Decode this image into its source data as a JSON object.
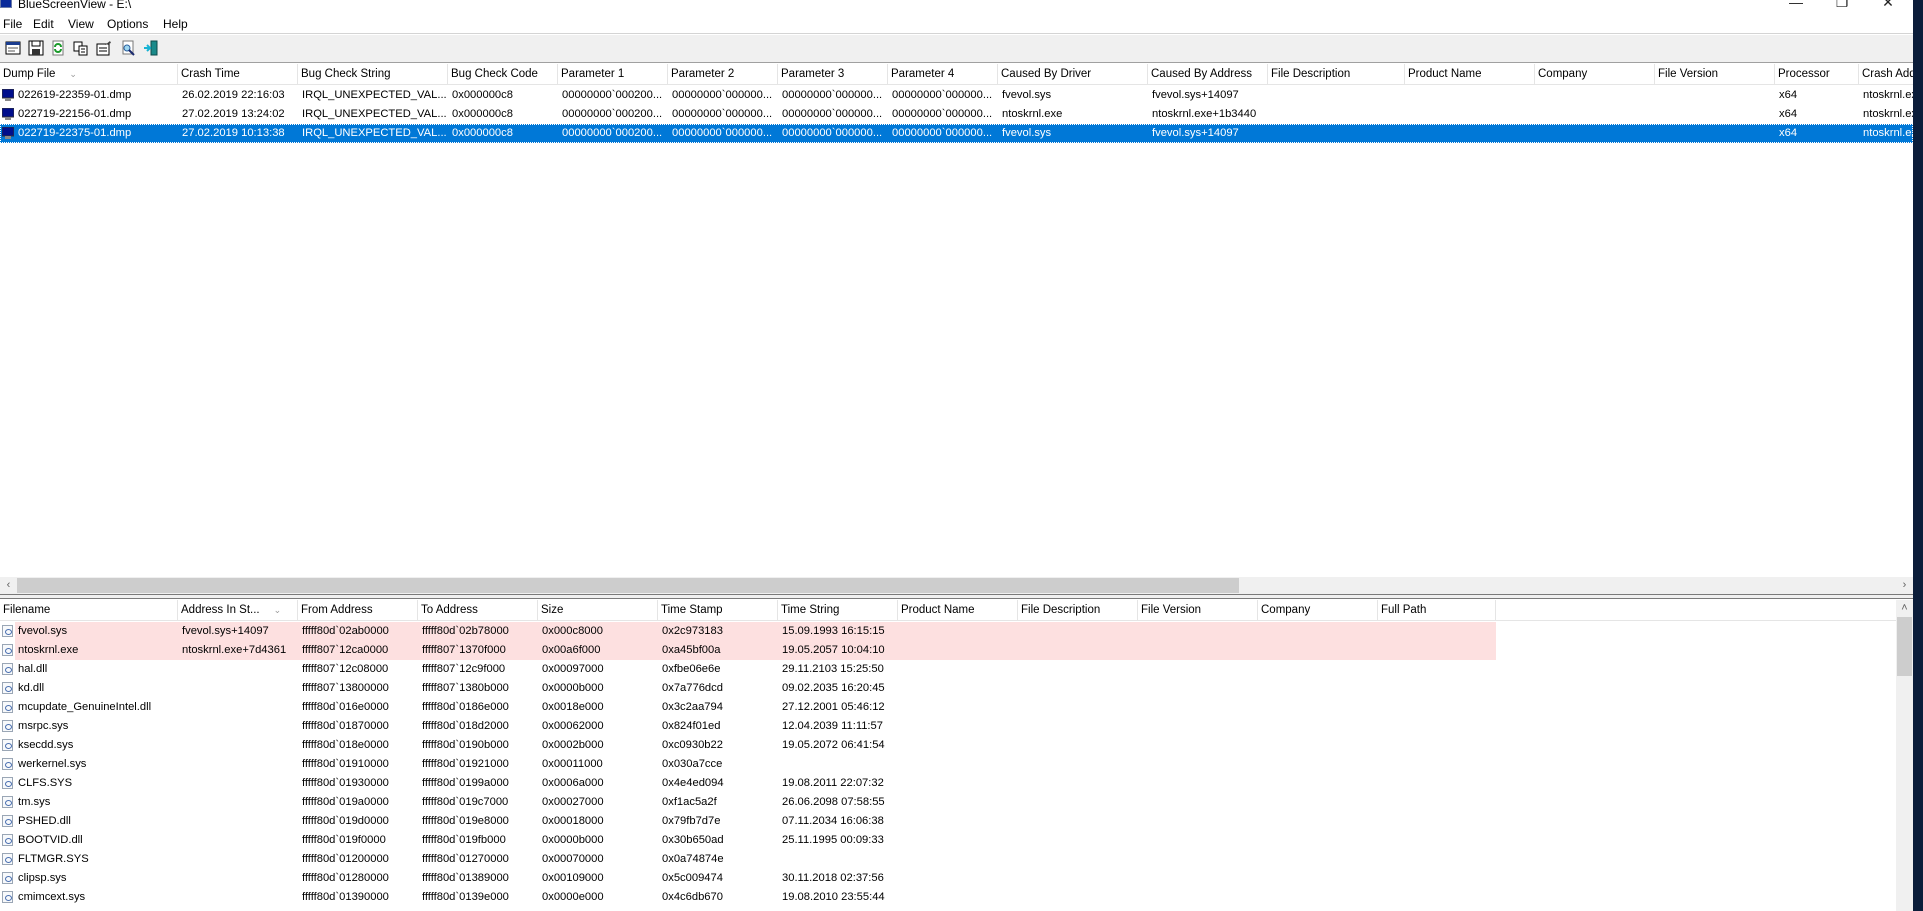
{
  "window": {
    "title": "BlueScreenView  -  E:\\",
    "controls": {
      "minimize": "—",
      "maximize": "❐",
      "close": "✕"
    }
  },
  "menu": [
    "File",
    "Edit",
    "View",
    "Options",
    "Help"
  ],
  "toolbar": [
    {
      "name": "properties-icon",
      "tooltip": "HTML report"
    },
    {
      "name": "save-icon",
      "tooltip": "Save"
    },
    {
      "name": "refresh-icon",
      "tooltip": "Refresh"
    },
    {
      "name": "copy-icon",
      "tooltip": "Copy"
    },
    {
      "name": "options-icon",
      "tooltip": "Properties"
    },
    {
      "name": "find-icon",
      "tooltip": "Find"
    },
    {
      "name": "exit-icon",
      "tooltip": "Exit"
    }
  ],
  "crash_list": {
    "columns": [
      "Dump File",
      "Crash Time",
      "Bug Check String",
      "Bug Check Code",
      "Parameter 1",
      "Parameter 2",
      "Parameter 3",
      "Parameter 4",
      "Caused By Driver",
      "Caused By Address",
      "File Description",
      "Product Name",
      "Company",
      "File Version",
      "Processor",
      "Crash Address"
    ],
    "sort_indicator": "⌄",
    "rows": [
      {
        "dump_file": "022619-22359-01.dmp",
        "crash_time": "26.02.2019 22:16:03",
        "bug_check_string": "IRQL_UNEXPECTED_VAL...",
        "bug_check_code": "0x000000c8",
        "p1": "00000000`000200...",
        "p2": "00000000`000000...",
        "p3": "00000000`000000...",
        "p4": "00000000`000000...",
        "driver": "fvevol.sys",
        "address": "fvevol.sys+14097",
        "file_desc": "",
        "product": "",
        "company": "",
        "file_version": "",
        "processor": "x64",
        "crash_address": "ntoskrnl.exe",
        "selected": false
      },
      {
        "dump_file": "022719-22156-01.dmp",
        "crash_time": "27.02.2019 13:24:02",
        "bug_check_string": "IRQL_UNEXPECTED_VAL...",
        "bug_check_code": "0x000000c8",
        "p1": "00000000`000200...",
        "p2": "00000000`000000...",
        "p3": "00000000`000000...",
        "p4": "00000000`000000...",
        "driver": "ntoskrnl.exe",
        "address": "ntoskrnl.exe+1b3440",
        "file_desc": "",
        "product": "",
        "company": "",
        "file_version": "",
        "processor": "x64",
        "crash_address": "ntoskrnl.exe",
        "selected": false
      },
      {
        "dump_file": "022719-22375-01.dmp",
        "crash_time": "27.02.2019 10:13:38",
        "bug_check_string": "IRQL_UNEXPECTED_VAL...",
        "bug_check_code": "0x000000c8",
        "p1": "00000000`000200...",
        "p2": "00000000`000000...",
        "p3": "00000000`000000...",
        "p4": "00000000`000000...",
        "driver": "fvevol.sys",
        "address": "fvevol.sys+14097",
        "file_desc": "",
        "product": "",
        "company": "",
        "file_version": "",
        "processor": "x64",
        "crash_address": "ntoskrnl.exe",
        "selected": true
      }
    ]
  },
  "scroll": {
    "left": "‹",
    "right": "›",
    "up": "˄"
  },
  "module_list": {
    "columns": [
      "Filename",
      "Address In St...",
      "From Address",
      "To Address",
      "Size",
      "Time Stamp",
      "Time String",
      "Product Name",
      "File Description",
      "File Version",
      "Company",
      "Full Path"
    ],
    "sort_indicator": "⌄",
    "highlight_color": "#fde0e0",
    "rows": [
      {
        "filename": "fvevol.sys",
        "addr_in_stack": "fvevol.sys+14097",
        "from": "fffff80d`02ab0000",
        "to": "fffff80d`02b78000",
        "size": "0x000c8000",
        "timestamp": "0x2c973183",
        "timestring": "15.09.1993 16:15:15",
        "highlight": true
      },
      {
        "filename": "ntoskrnl.exe",
        "addr_in_stack": "ntoskrnl.exe+7d4361",
        "from": "fffff807`12ca0000",
        "to": "fffff807`1370f000",
        "size": "0x00a6f000",
        "timestamp": "0xa45bf00a",
        "timestring": "19.05.2057 10:04:10",
        "highlight": true
      },
      {
        "filename": "hal.dll",
        "addr_in_stack": "",
        "from": "fffff807`12c08000",
        "to": "fffff807`12c9f000",
        "size": "0x00097000",
        "timestamp": "0xfbe06e6e",
        "timestring": "29.11.2103 15:25:50",
        "highlight": false
      },
      {
        "filename": "kd.dll",
        "addr_in_stack": "",
        "from": "fffff807`13800000",
        "to": "fffff807`1380b000",
        "size": "0x0000b000",
        "timestamp": "0x7a776dcd",
        "timestring": "09.02.2035 16:20:45",
        "highlight": false
      },
      {
        "filename": "mcupdate_GenuineIntel.dll",
        "addr_in_stack": "",
        "from": "fffff80d`016e0000",
        "to": "fffff80d`0186e000",
        "size": "0x0018e000",
        "timestamp": "0x3c2aa794",
        "timestring": "27.12.2001 05:46:12",
        "highlight": false
      },
      {
        "filename": "msrpc.sys",
        "addr_in_stack": "",
        "from": "fffff80d`01870000",
        "to": "fffff80d`018d2000",
        "size": "0x00062000",
        "timestamp": "0x824f01ed",
        "timestring": "12.04.2039 11:11:57",
        "highlight": false
      },
      {
        "filename": "ksecdd.sys",
        "addr_in_stack": "",
        "from": "fffff80d`018e0000",
        "to": "fffff80d`0190b000",
        "size": "0x0002b000",
        "timestamp": "0xc0930b22",
        "timestring": "19.05.2072 06:41:54",
        "highlight": false
      },
      {
        "filename": "werkernel.sys",
        "addr_in_stack": "",
        "from": "fffff80d`01910000",
        "to": "fffff80d`01921000",
        "size": "0x00011000",
        "timestamp": "0x030a7cce",
        "timestring": "",
        "highlight": false
      },
      {
        "filename": "CLFS.SYS",
        "addr_in_stack": "",
        "from": "fffff80d`01930000",
        "to": "fffff80d`0199a000",
        "size": "0x0006a000",
        "timestamp": "0x4e4ed094",
        "timestring": "19.08.2011 22:07:32",
        "highlight": false
      },
      {
        "filename": "tm.sys",
        "addr_in_stack": "",
        "from": "fffff80d`019a0000",
        "to": "fffff80d`019c7000",
        "size": "0x00027000",
        "timestamp": "0xf1ac5a2f",
        "timestring": "26.06.2098 07:58:55",
        "highlight": false
      },
      {
        "filename": "PSHED.dll",
        "addr_in_stack": "",
        "from": "fffff80d`019d0000",
        "to": "fffff80d`019e8000",
        "size": "0x00018000",
        "timestamp": "0x79fb7d7e",
        "timestring": "07.11.2034 16:06:38",
        "highlight": false
      },
      {
        "filename": "BOOTVID.dll",
        "addr_in_stack": "",
        "from": "fffff80d`019f0000",
        "to": "fffff80d`019fb000",
        "size": "0x0000b000",
        "timestamp": "0x30b650ad",
        "timestring": "25.11.1995 00:09:33",
        "highlight": false
      },
      {
        "filename": "FLTMGR.SYS",
        "addr_in_stack": "",
        "from": "fffff80d`01200000",
        "to": "fffff80d`01270000",
        "size": "0x00070000",
        "timestamp": "0x0a74874e",
        "timestring": "",
        "highlight": false
      },
      {
        "filename": "clipsp.sys",
        "addr_in_stack": "",
        "from": "fffff80d`01280000",
        "to": "fffff80d`01389000",
        "size": "0x00109000",
        "timestamp": "0x5c009474",
        "timestring": "30.11.2018 02:37:56",
        "highlight": false
      },
      {
        "filename": "cmimcext.sys",
        "addr_in_stack": "",
        "from": "fffff80d`01390000",
        "to": "fffff80d`0139e000",
        "size": "0x0000e000",
        "timestamp": "0x4c6db670",
        "timestring": "19.08.2010 23:55:44",
        "highlight": false
      }
    ]
  },
  "colors": {
    "selection": "#0078d7",
    "highlight": "#fde0e0",
    "desktop": "#0b1d3a"
  }
}
